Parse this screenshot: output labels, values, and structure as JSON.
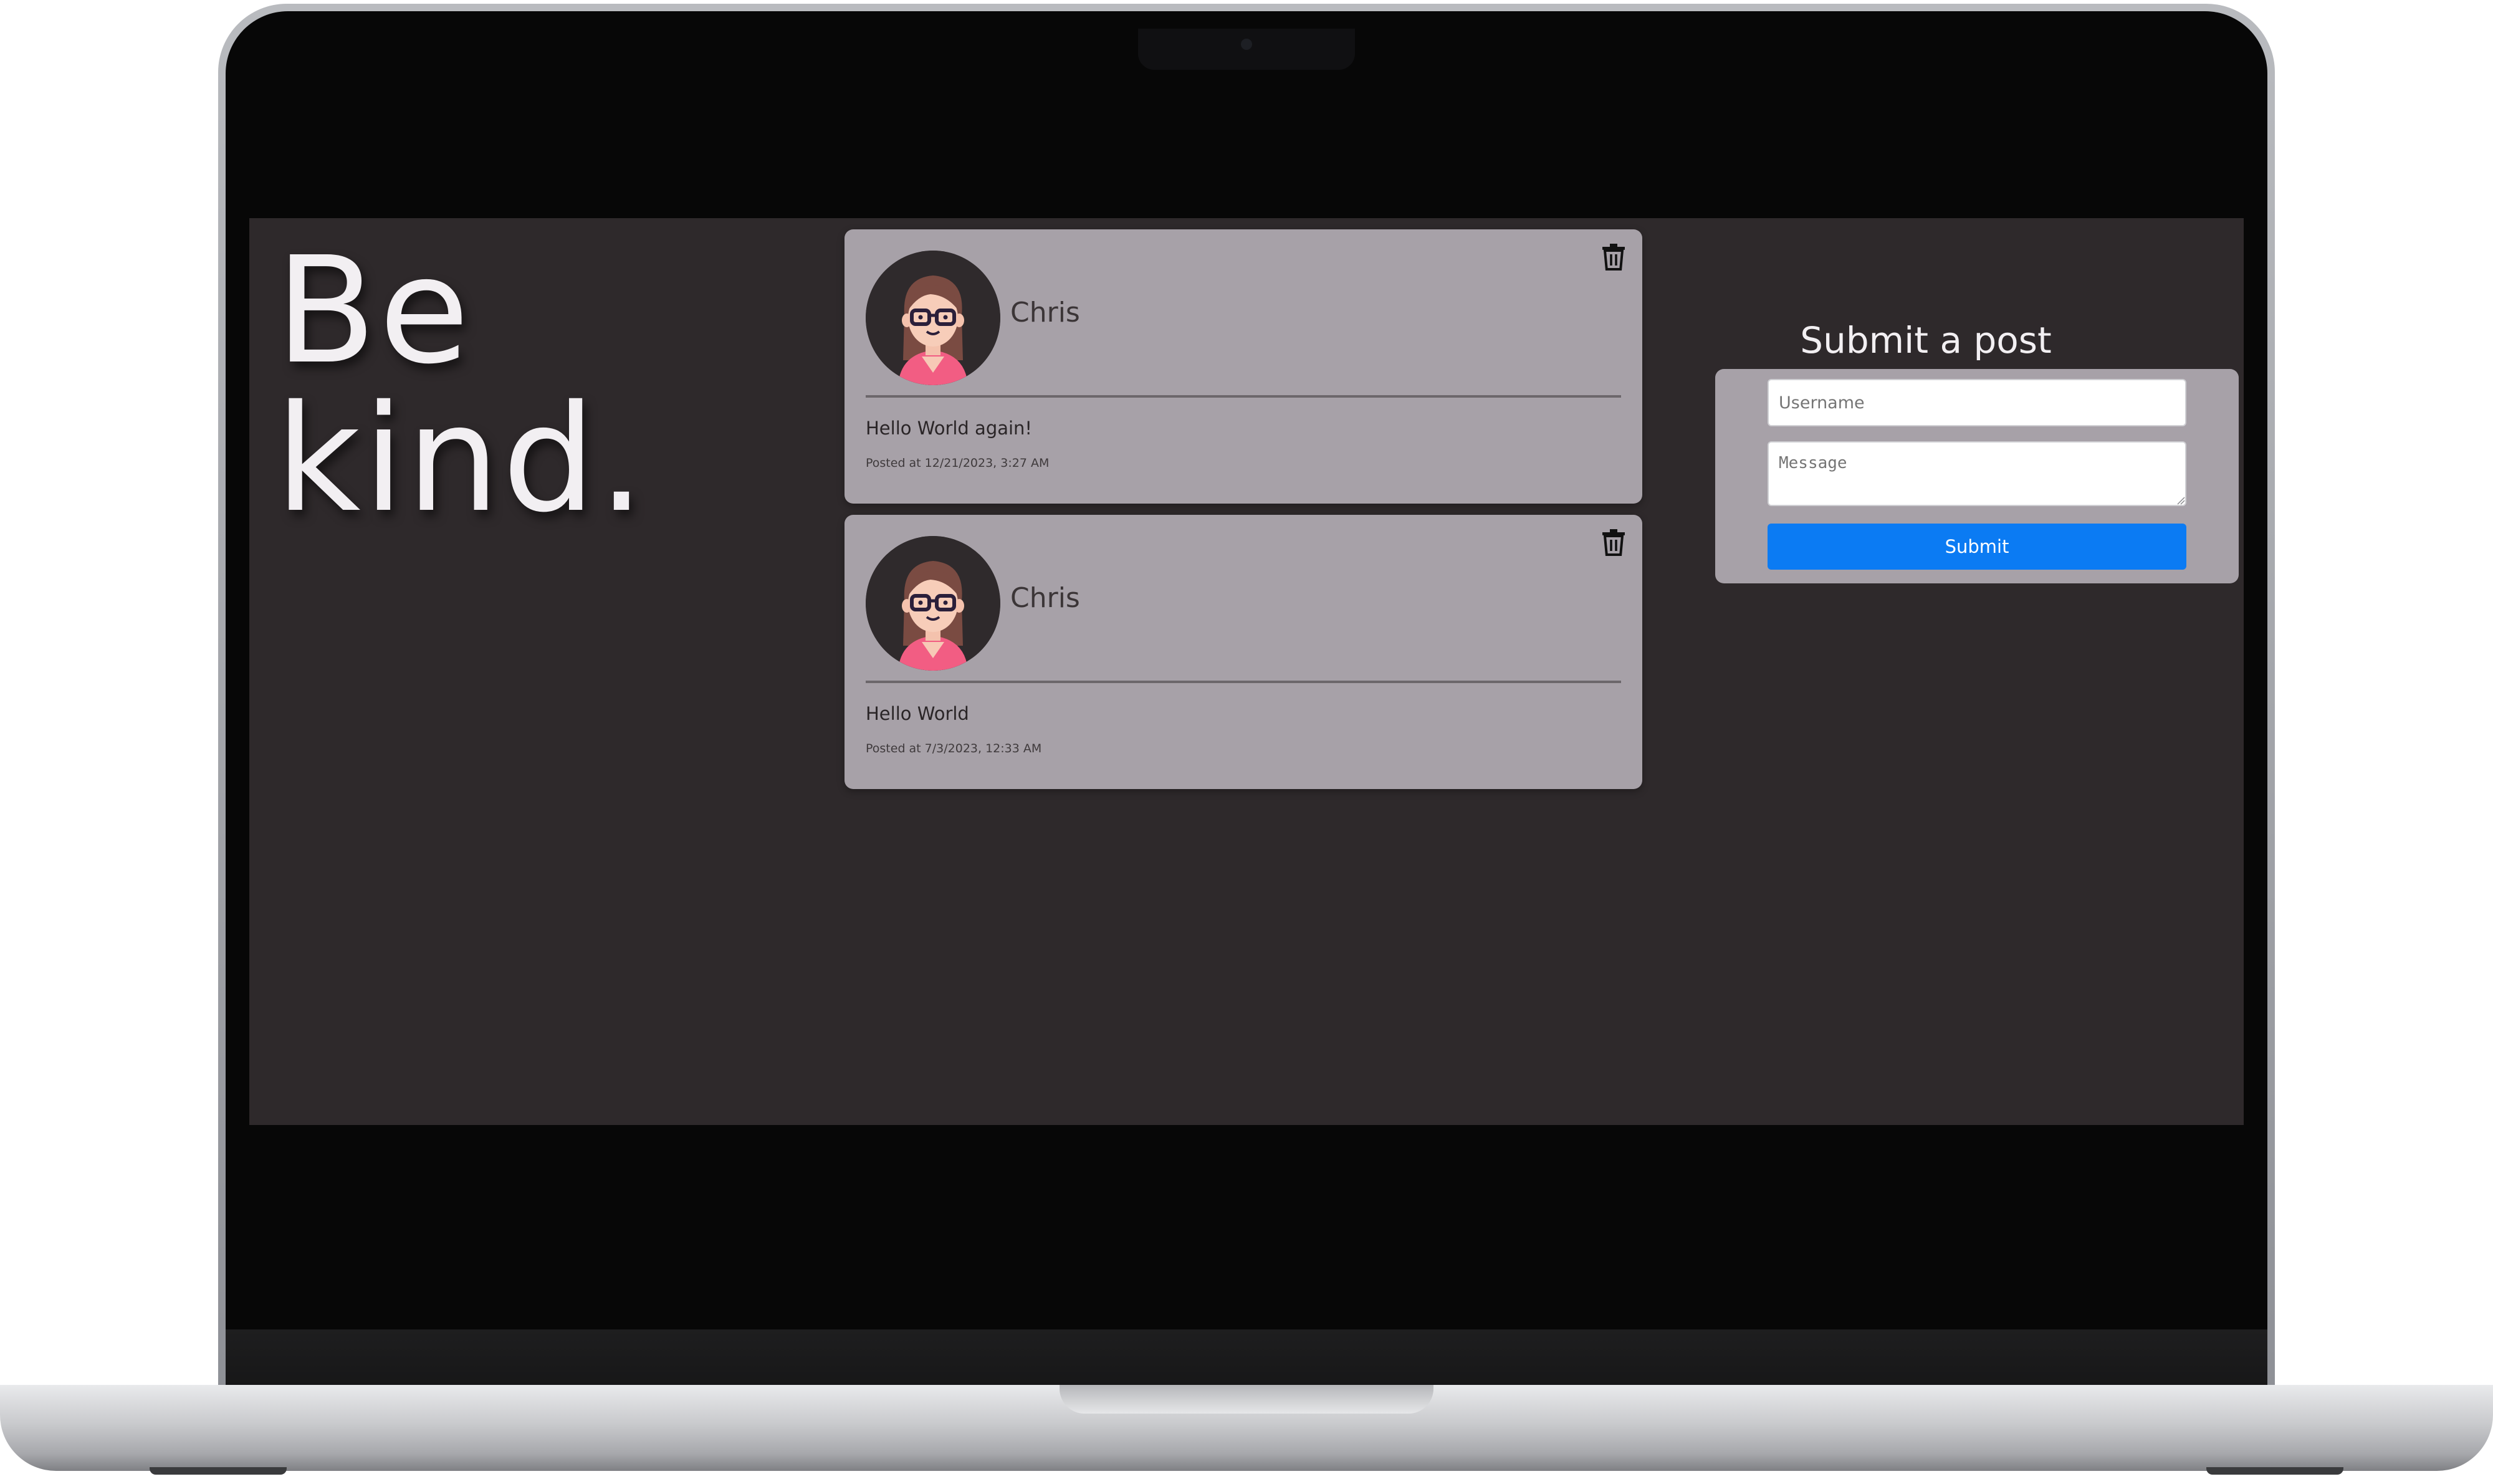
{
  "hero": {
    "text": "Be\nkind."
  },
  "posts": [
    {
      "username": "Chris",
      "message": "Hello World again!",
      "timestamp": "Posted at 12/21/2023, 3:27 AM",
      "delete_icon": "trash-icon"
    },
    {
      "username": "Chris",
      "message": "Hello World",
      "timestamp": "Posted at 7/3/2023, 12:33 AM",
      "delete_icon": "trash-icon"
    }
  ],
  "form": {
    "title": "Submit a post",
    "username_placeholder": "Username",
    "message_placeholder": "Message",
    "submit_label": "Submit"
  },
  "colors": {
    "page_background": "#2e292b",
    "card_background": "#a7a1a8",
    "submit_button": "#0b7bf3",
    "hero_text": "#f2eff2"
  }
}
